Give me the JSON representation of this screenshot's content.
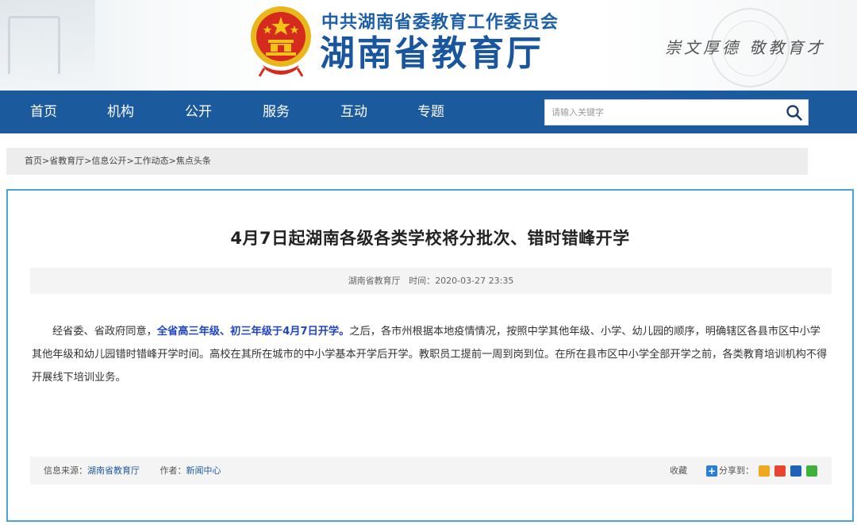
{
  "header": {
    "org_name": "中共湖南省委教育工作委员会",
    "site_name": "湖南省教育厅",
    "motto": "崇文厚德  敬教育才",
    "colors": {
      "nav_bg": "#1c5a9e",
      "title_blue": "#1a56a0",
      "emblem_red": "#d42b1e",
      "emblem_gold": "#f3c318"
    }
  },
  "nav": {
    "items": [
      {
        "label": "首页"
      },
      {
        "label": "机构"
      },
      {
        "label": "公开"
      },
      {
        "label": "服务"
      },
      {
        "label": "互动"
      },
      {
        "label": "专题"
      }
    ],
    "search_placeholder": "请输入关键字",
    "search_icon": "search-icon"
  },
  "breadcrumb": {
    "items": [
      "首页",
      "省教育厅",
      "信息公开",
      "工作动态",
      "焦点头条"
    ],
    "separator": ">"
  },
  "article": {
    "title": "4月7日起湖南各级各类学校将分批次、错时错峰开学",
    "source_label": "湖南省教育厅",
    "time_label": "时间：",
    "time": "2020-03-27 23:35",
    "body_before": "经省委、省政府同意，",
    "body_highlight": "全省高三年级、初三年级于4月7日开学。",
    "body_after": "之后，各市州根据本地疫情情况，按照中学其他年级、小学、幼儿园的顺序，明确辖区各县市区中小学其他年级和幼儿园错时错峰开学时间。高校在其所在城市的中小学基本开学后开学。教职员工提前一周到岗到位。在所在县市区中小学全部开学之前，各类教育培训机构不得开展线下培训业务。",
    "highlight_color": "#1f45c4"
  },
  "footer": {
    "source_label": "信息来源：",
    "source_value": "湖南省教育厅",
    "author_label": "作者：",
    "author_value": "新闻中心",
    "favorite_label": "收藏",
    "share_label": "分享到：",
    "share_icons": [
      {
        "name": "qzone-icon",
        "color": "#f0a81e"
      },
      {
        "name": "weibo-icon",
        "color": "#e6442f"
      },
      {
        "name": "renren-icon",
        "color": "#1e63b8"
      },
      {
        "name": "wechat-icon",
        "color": "#3fb03b"
      }
    ]
  }
}
